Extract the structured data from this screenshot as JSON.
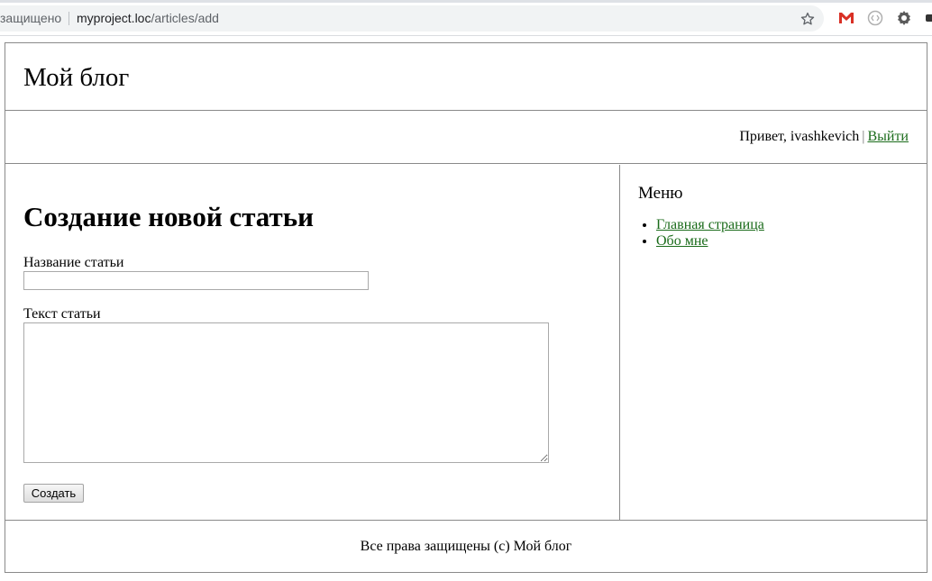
{
  "browser": {
    "security_text": "защищено",
    "url_host": "myproject.loc",
    "url_path": "/articles/add",
    "icons": [
      "star-icon",
      "gmail-icon",
      "extension-icon",
      "settings-icon"
    ]
  },
  "header": {
    "site_title": "Мой блог"
  },
  "userbar": {
    "greeting": "Привет, ivashkevich",
    "separator": "|",
    "logout_label": "Выйти"
  },
  "main": {
    "heading": "Создание новой статьи",
    "title_label": "Название статьи",
    "title_value": "",
    "text_label": "Текст статьи",
    "text_value": "",
    "submit_label": "Создать"
  },
  "sidebar": {
    "heading": "Меню",
    "items": [
      {
        "label": "Главная страница"
      },
      {
        "label": "Обо мне"
      }
    ]
  },
  "footer": {
    "text": "Все права защищены (с) Мой блог"
  },
  "colors": {
    "link": "#1a6b1a",
    "border": "#8a8a8a"
  }
}
